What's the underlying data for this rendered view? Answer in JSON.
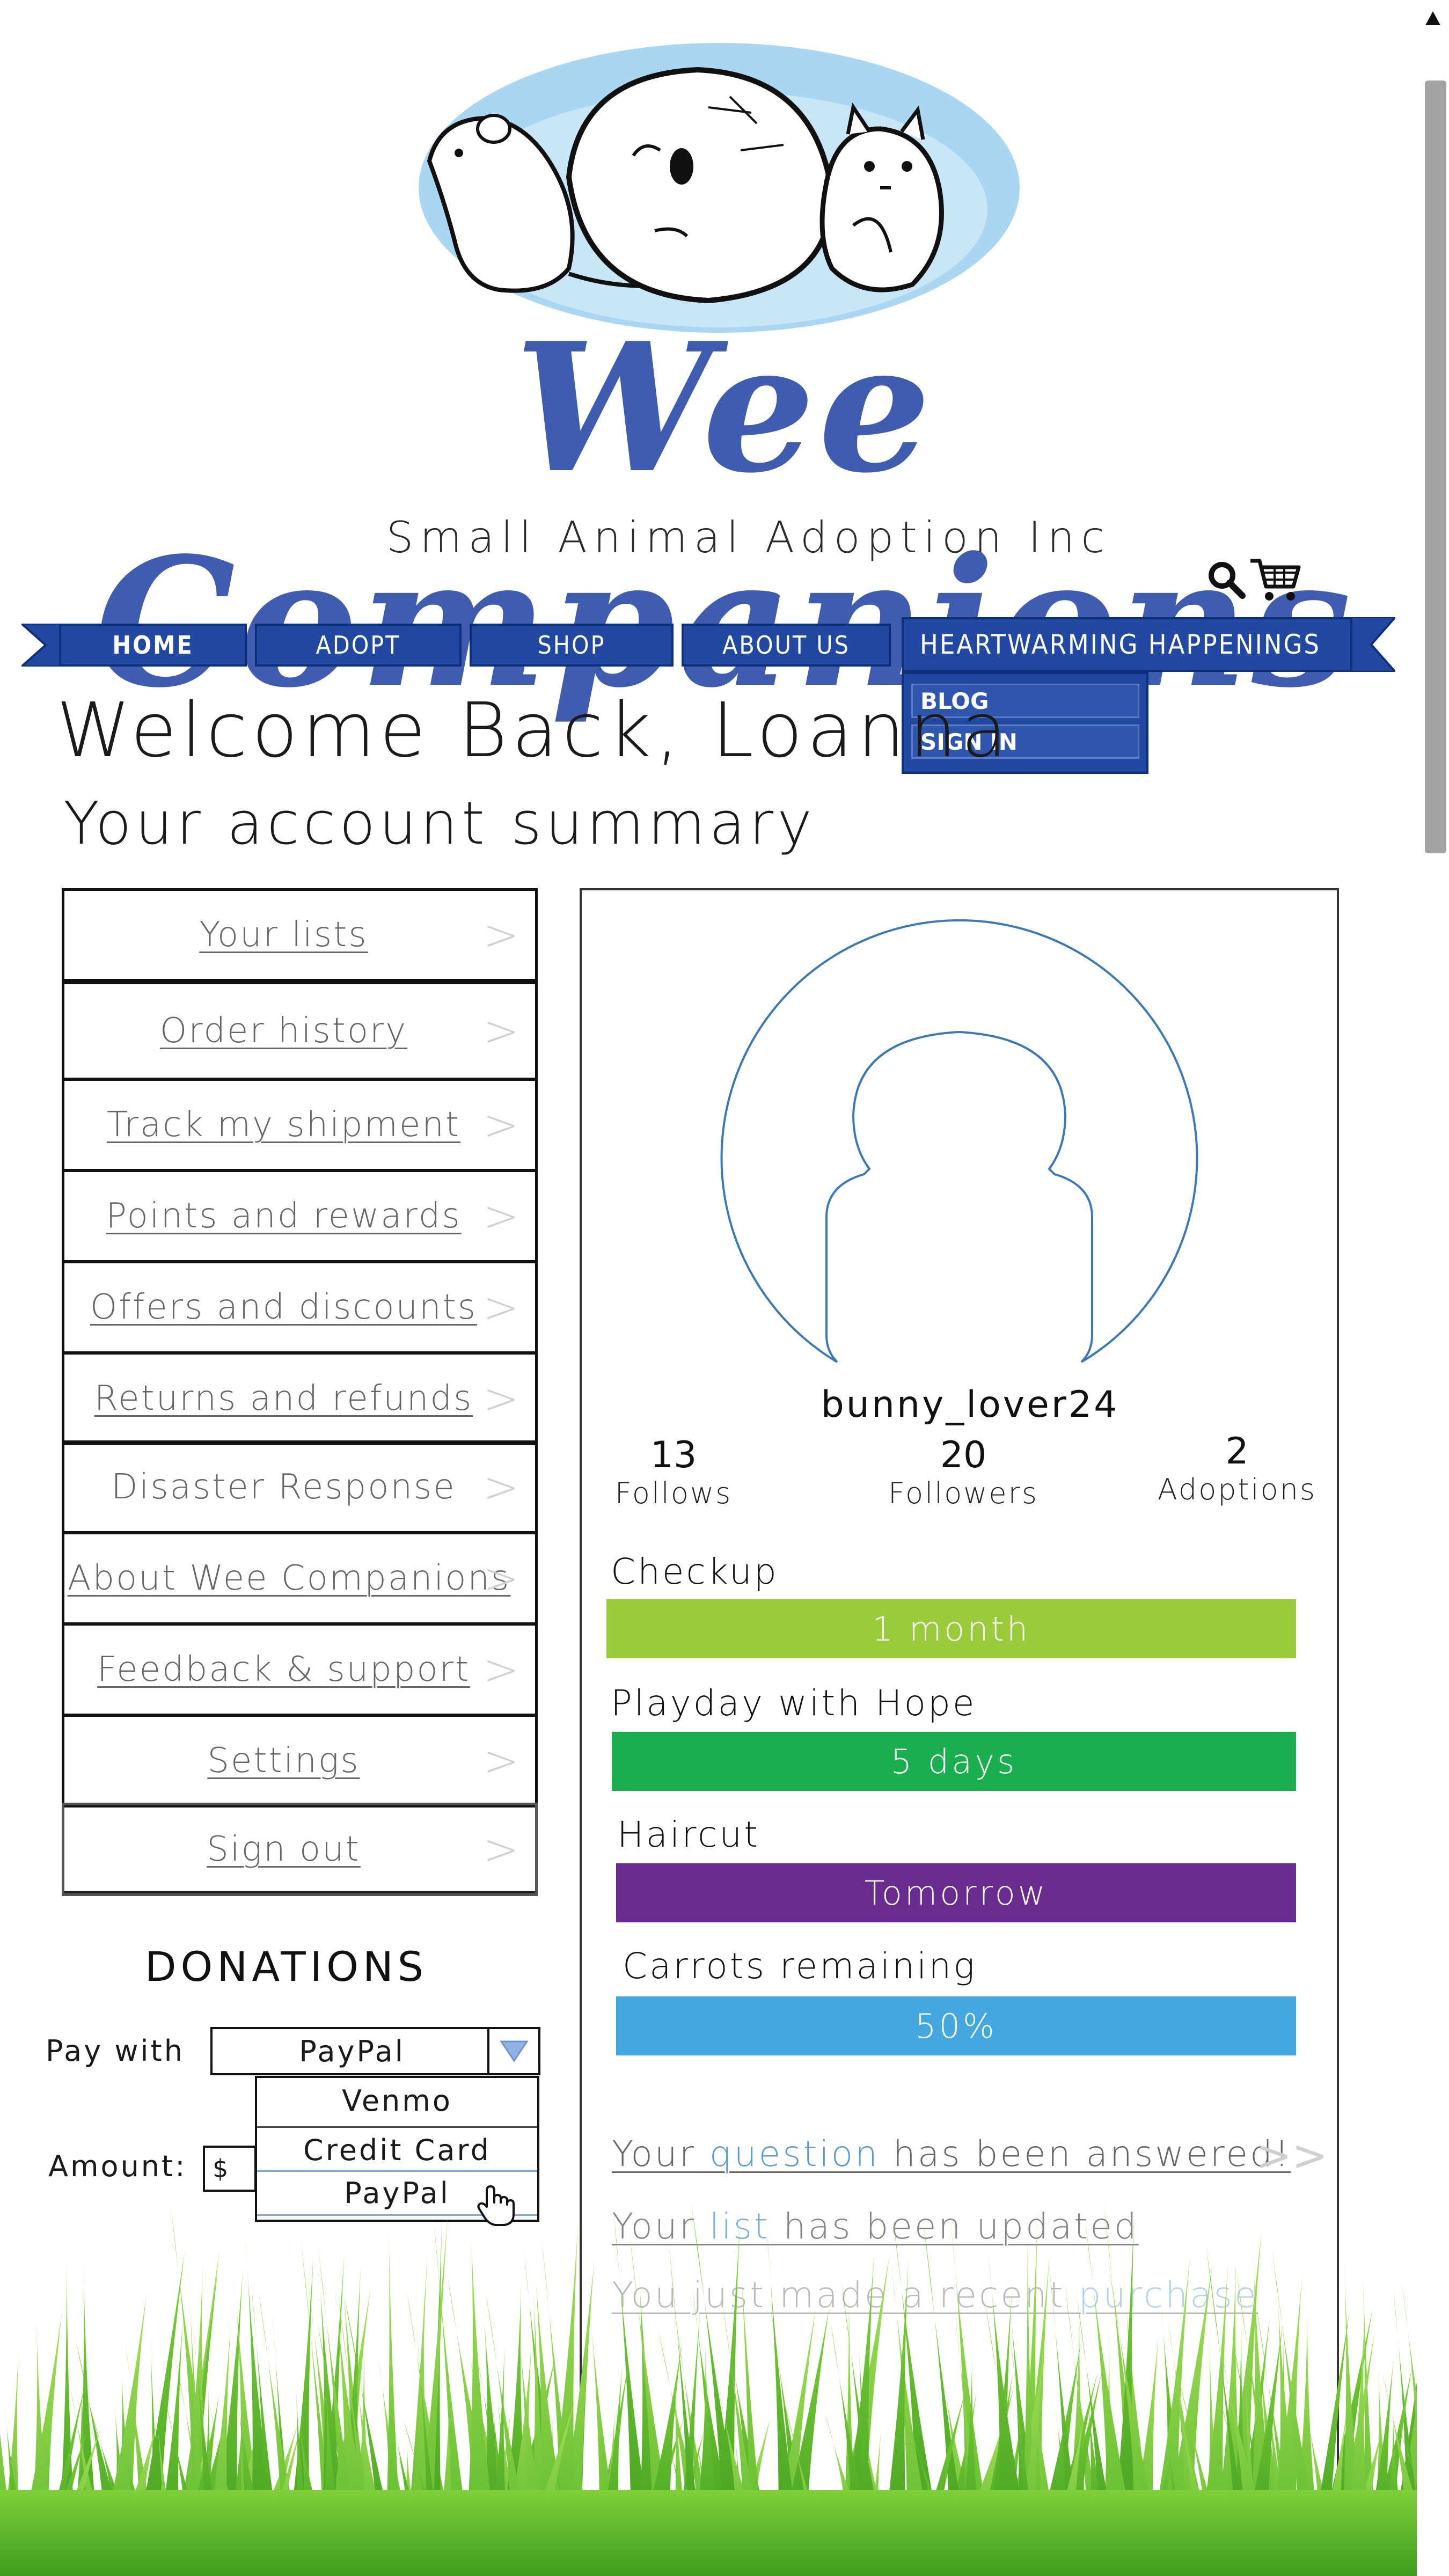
{
  "brand": {
    "title": "Wee Companions",
    "tagline": "Small Animal Adoption Inc"
  },
  "header_icons": [
    "search-icon",
    "cart-icon"
  ],
  "nav": {
    "home": "HOME",
    "adopt": "ADOPT",
    "shop": "SHOP",
    "about": "ABOUT US",
    "happenings": "HEARTWARMING HAPPENINGS",
    "happenings_menu": [
      "BLOG",
      "SIGN IN"
    ]
  },
  "welcome": {
    "title": "Welcome Back, Loanna",
    "subtitle": "Your account summary"
  },
  "account_menu": [
    {
      "label": "Your lists"
    },
    {
      "label": "Order history"
    },
    {
      "label": "Track my shipment"
    },
    {
      "label": "Points and rewards"
    },
    {
      "label": "Offers and discounts"
    },
    {
      "label": "Returns and refunds"
    },
    {
      "label": "Disaster Response"
    },
    {
      "label": "About Wee Companions"
    },
    {
      "label": "Feedback & support"
    },
    {
      "label": "Settings"
    },
    {
      "label": "Sign out"
    }
  ],
  "menu_chevron": ">",
  "donations": {
    "title": "DONATIONS",
    "pay_with_label": "Pay with",
    "selected_method": "PayPal",
    "options": [
      "Venmo",
      "Credit Card",
      "PayPal"
    ],
    "amount_label": "Amount:",
    "currency_symbol": "$"
  },
  "profile": {
    "username": "bunny_lover24",
    "stats": {
      "follows": {
        "value": "13",
        "label": "Follows"
      },
      "followers": {
        "value": "20",
        "label": "Followers"
      },
      "adoptions": {
        "value": "2",
        "label": "Adoptions"
      }
    },
    "schedule": {
      "checkup": {
        "label": "Checkup",
        "value": "1 month",
        "color": "#9acb3c"
      },
      "playday": {
        "label": "Playday with Hope",
        "value": "5 days",
        "color": "#1aae4f"
      },
      "haircut": {
        "label": "Haircut",
        "value": "Tomorrow",
        "color": "#672c8d"
      },
      "carrots": {
        "label": "Carrots remaining",
        "value": "50%",
        "color": "#44a8e0",
        "fraction": 0.5
      }
    },
    "notifications": {
      "n1": {
        "before": "Your ",
        "link": "question",
        "after": " has been answered!"
      },
      "n2": {
        "before": "Your ",
        "link": "list",
        "after": " has been updated"
      },
      "n3": {
        "before": "You just made a recent ",
        "link": "purchase",
        "after": ""
      }
    },
    "notification_chevron": ">>"
  },
  "colors": {
    "brand_blue": "#3f5cae",
    "nav_blue": "#2149a2",
    "link_blue": "#5b9bd5"
  }
}
